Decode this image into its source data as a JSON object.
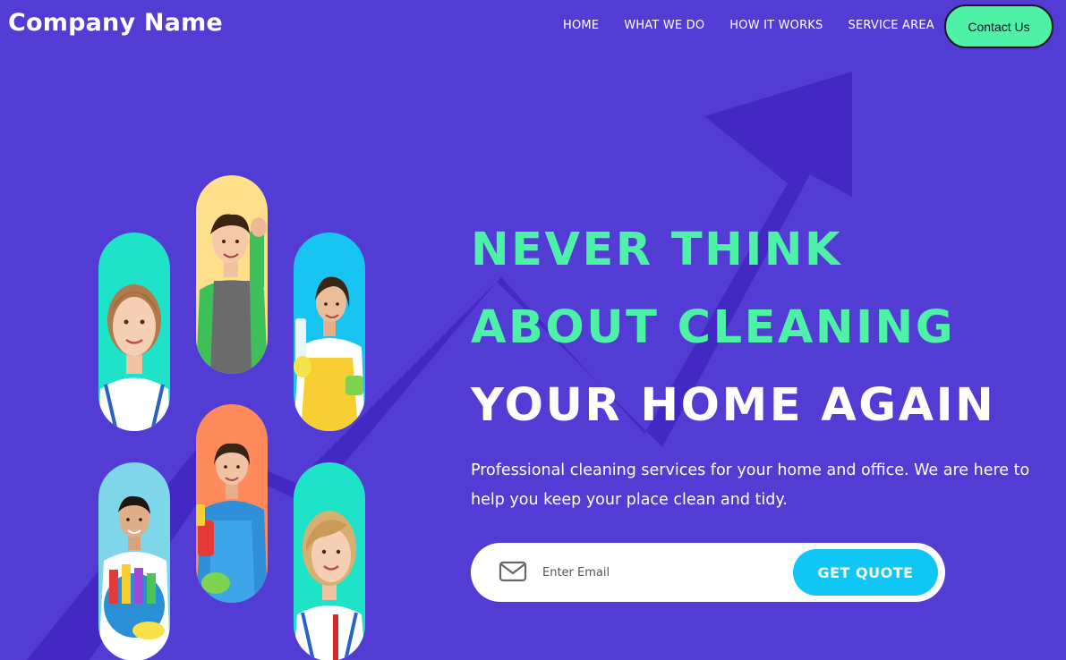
{
  "header": {
    "brand": "Company Name",
    "nav": [
      "HOME",
      "WHAT WE DO",
      "HOW IT WORKS",
      "SERVICE AREA"
    ],
    "contact_label": "Contact Us"
  },
  "hero": {
    "headline_line1": "NEVER THINK",
    "headline_line2": "ABOUT CLEANING",
    "headline_line3": "YOUR HOME AGAIN",
    "subtext": "Professional cleaning services for your home and office. We are here to help you keep your place clean and tidy."
  },
  "form": {
    "email_placeholder": "Enter Email",
    "submit_label": "GET QUOTE"
  },
  "photos": [
    {
      "name": "photo-woman-smiling-1",
      "bg": "#1ee3c8"
    },
    {
      "name": "photo-man-with-gloves",
      "bg": "#ffe08a"
    },
    {
      "name": "photo-woman-with-spray",
      "bg": "#17c4f2"
    },
    {
      "name": "photo-man-with-supplies",
      "bg": "#7fd6e8"
    },
    {
      "name": "photo-woman-with-bucket",
      "bg": "#ff8a5c"
    },
    {
      "name": "photo-woman-smiling-2",
      "bg": "#1ee3c8"
    }
  ],
  "colors": {
    "background": "#523cd4",
    "accent_green": "#4ef2a6",
    "accent_blue": "#10c6f5",
    "arrow": "#4428c4"
  },
  "icons": {
    "mail": "mail-icon",
    "arrow": "trend-arrow-icon"
  }
}
